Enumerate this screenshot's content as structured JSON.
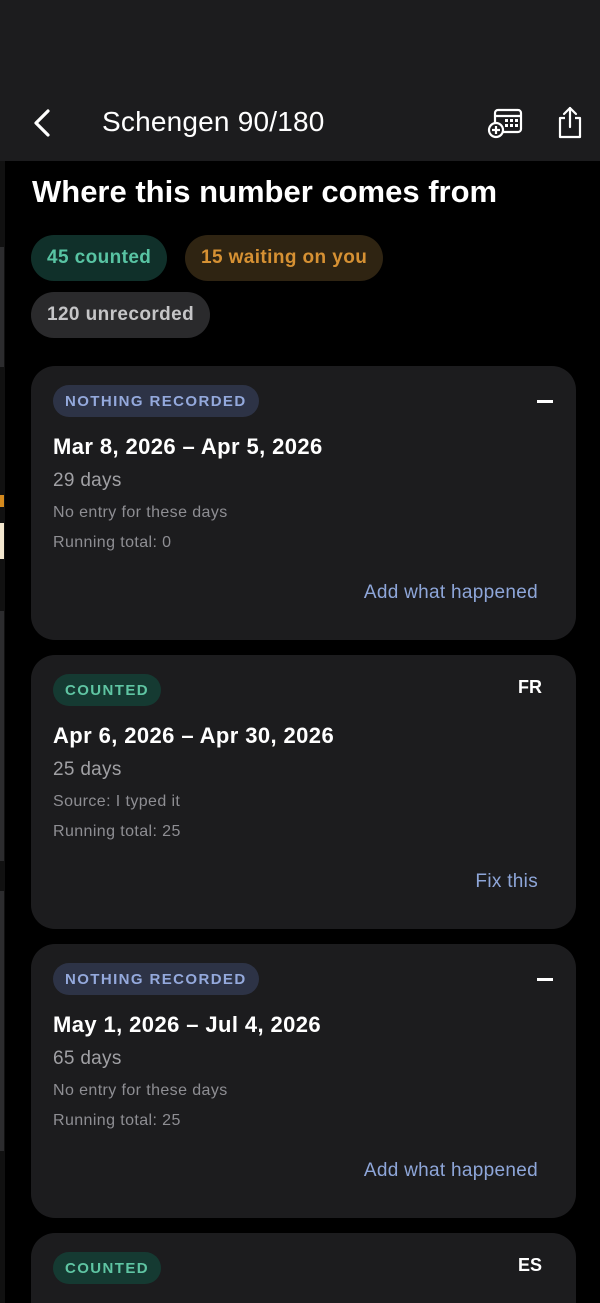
{
  "header": {
    "title": "Schengen 90/180",
    "icons": [
      "back-chevron-icon",
      "calendar-add-icon",
      "share-icon"
    ]
  },
  "heading": "Where this number comes from",
  "chips": {
    "counted": "45 counted",
    "waiting": "15 waiting on you",
    "unrecorded": "120 unrecorded"
  },
  "cards": [
    {
      "badge": "NOTHING RECORDED",
      "corner": "",
      "range": "Mar 8, 2026 – Apr 5, 2026",
      "days": "29 days",
      "detail": "No entry for these days",
      "total": "Running total: 0",
      "action": "Add what happened"
    },
    {
      "badge": "COUNTED",
      "corner": "FR",
      "range": "Apr 6, 2026 – Apr 30, 2026",
      "days": "25 days",
      "detail": "Source: I typed it",
      "total": "Running total: 25",
      "action": "Fix this"
    },
    {
      "badge": "NOTHING RECORDED",
      "corner": "",
      "range": "May 1, 2026 – Jul 4, 2026",
      "days": "65 days",
      "detail": "No entry for these days",
      "total": "Running total: 25",
      "action": "Add what happened"
    },
    {
      "badge": "COUNTED",
      "corner": "ES",
      "range": "",
      "days": "",
      "detail": "",
      "total": "",
      "action": ""
    }
  ],
  "colors": {
    "background": "#000000",
    "surface": "#1c1c1e",
    "counted": "#58c4a3",
    "waiting": "#d69133",
    "link": "#8ea6d9"
  }
}
